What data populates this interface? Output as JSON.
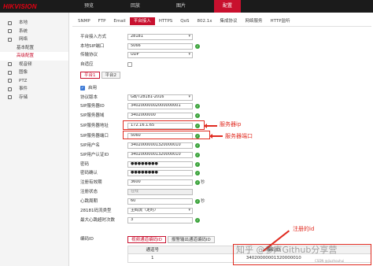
{
  "app": {
    "logo": "HIKVISION"
  },
  "topnav": [
    {
      "label": "预览",
      "active": false
    },
    {
      "label": "回放",
      "active": false
    },
    {
      "label": "图片",
      "active": false
    },
    {
      "label": "配置",
      "active": true
    }
  ],
  "sidebar": [
    {
      "label": "本地",
      "icon": "monitor-icon"
    },
    {
      "label": "系统",
      "icon": "system-icon"
    },
    {
      "label": "网络",
      "icon": "network-icon"
    },
    {
      "label": "基本配置",
      "icon": "",
      "sub": true
    },
    {
      "label": "高级配置",
      "icon": "",
      "sub": true,
      "active": true
    },
    {
      "label": "视音频",
      "icon": "video-icon"
    },
    {
      "label": "图像",
      "icon": "image-icon"
    },
    {
      "label": "PTZ",
      "icon": "ptz-icon"
    },
    {
      "label": "事件",
      "icon": "event-icon"
    },
    {
      "label": "存储",
      "icon": "storage-icon"
    }
  ],
  "subtabs": [
    {
      "label": "SNMP",
      "active": false
    },
    {
      "label": "FTP",
      "active": false
    },
    {
      "label": "Email",
      "active": false
    },
    {
      "label": "平台接入",
      "active": true
    },
    {
      "label": "HTTPS",
      "active": false
    },
    {
      "label": "QoS",
      "active": false
    },
    {
      "label": "802.1x",
      "active": false
    },
    {
      "label": "集成协议",
      "active": false
    },
    {
      "label": "网络服务",
      "active": false
    },
    {
      "label": "HTTP监听",
      "active": false
    }
  ],
  "top_form": {
    "access_mode_label": "平台接入方式",
    "access_mode": "28181",
    "local_sip_port_label": "本地SIP端口",
    "local_sip_port": "5066",
    "transport_label": "传输协议",
    "transport": "UDP",
    "auto_adapt_label": "自适应"
  },
  "platform_tabs": [
    {
      "label": "平台1",
      "active": true
    },
    {
      "label": "平台2",
      "active": false
    }
  ],
  "enable_label": "启用",
  "form": {
    "protocol_version_label": "协议版本",
    "protocol_version": "GB/T28181-2016",
    "sip_server_id_label": "SIP服务器ID",
    "sip_server_id": "34020000002000000001",
    "sip_server_domain_label": "SIP服务器域",
    "sip_server_domain": "3402000000",
    "sip_server_addr_label": "SIP服务器地址",
    "sip_server_addr": "172.16.1.65",
    "sip_server_port_label": "SIP服务器端口",
    "sip_server_port": "5060",
    "sip_username_label": "SIP用户名",
    "sip_username": "34020000001320000010",
    "sip_auth_id_label": "SIP用户认证ID",
    "sip_auth_id": "34020000001320000010",
    "password_label": "密码",
    "password": "●●●●●●●●",
    "password_confirm_label": "密码确认",
    "password_confirm": "●●●●●●●●",
    "register_validity_label": "注册有效期",
    "register_validity": "3600",
    "register_validity_unit": "秒",
    "register_status_label": "注册状态",
    "register_status": "在线",
    "heartbeat_label": "心跳周期",
    "heartbeat": "60",
    "heartbeat_unit": "秒",
    "stream_type_label": "28181码流类型",
    "stream_type": "主码流（定时）",
    "max_heartbeat_label": "最大心跳超时次数",
    "max_heartbeat": "3",
    "encode_id_label": "编码ID"
  },
  "annotations": {
    "server_ip": "服务器ip",
    "server_port": "服务器端口",
    "registered_id": "注册的id"
  },
  "channel_tabs": [
    {
      "label": "视频通道编码ID",
      "active": true
    },
    {
      "label": "报警输出通道编码ID",
      "active": false
    }
  ],
  "table": {
    "headers": [
      "通道号",
      "编码ID"
    ],
    "rows": [
      [
        "1",
        "34020000001320000010"
      ]
    ]
  },
  "watermark": "知乎 @参声Github分享营",
  "csdn": "CSDN @jiuzhouhui"
}
